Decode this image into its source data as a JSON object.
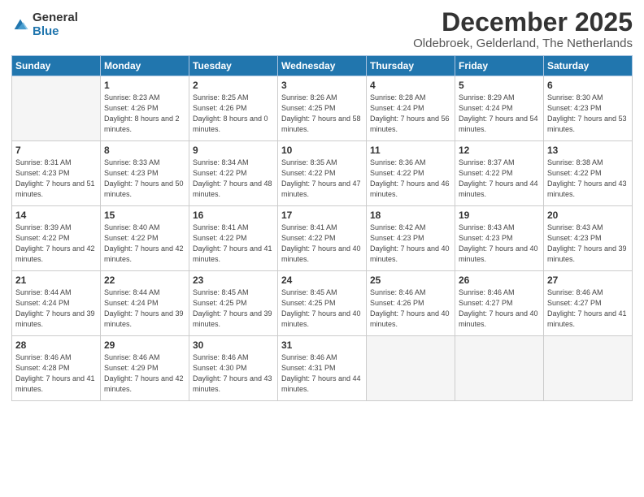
{
  "logo": {
    "general": "General",
    "blue": "Blue"
  },
  "title": "December 2025",
  "subtitle": "Oldebroek, Gelderland, The Netherlands",
  "headers": [
    "Sunday",
    "Monday",
    "Tuesday",
    "Wednesday",
    "Thursday",
    "Friday",
    "Saturday"
  ],
  "weeks": [
    [
      {
        "day": "",
        "sunrise": "",
        "sunset": "",
        "daylight": "",
        "empty": true
      },
      {
        "day": "1",
        "sunrise": "Sunrise: 8:23 AM",
        "sunset": "Sunset: 4:26 PM",
        "daylight": "Daylight: 8 hours and 2 minutes."
      },
      {
        "day": "2",
        "sunrise": "Sunrise: 8:25 AM",
        "sunset": "Sunset: 4:26 PM",
        "daylight": "Daylight: 8 hours and 0 minutes."
      },
      {
        "day": "3",
        "sunrise": "Sunrise: 8:26 AM",
        "sunset": "Sunset: 4:25 PM",
        "daylight": "Daylight: 7 hours and 58 minutes."
      },
      {
        "day": "4",
        "sunrise": "Sunrise: 8:28 AM",
        "sunset": "Sunset: 4:24 PM",
        "daylight": "Daylight: 7 hours and 56 minutes."
      },
      {
        "day": "5",
        "sunrise": "Sunrise: 8:29 AM",
        "sunset": "Sunset: 4:24 PM",
        "daylight": "Daylight: 7 hours and 54 minutes."
      },
      {
        "day": "6",
        "sunrise": "Sunrise: 8:30 AM",
        "sunset": "Sunset: 4:23 PM",
        "daylight": "Daylight: 7 hours and 53 minutes."
      }
    ],
    [
      {
        "day": "7",
        "sunrise": "Sunrise: 8:31 AM",
        "sunset": "Sunset: 4:23 PM",
        "daylight": "Daylight: 7 hours and 51 minutes."
      },
      {
        "day": "8",
        "sunrise": "Sunrise: 8:33 AM",
        "sunset": "Sunset: 4:23 PM",
        "daylight": "Daylight: 7 hours and 50 minutes."
      },
      {
        "day": "9",
        "sunrise": "Sunrise: 8:34 AM",
        "sunset": "Sunset: 4:22 PM",
        "daylight": "Daylight: 7 hours and 48 minutes."
      },
      {
        "day": "10",
        "sunrise": "Sunrise: 8:35 AM",
        "sunset": "Sunset: 4:22 PM",
        "daylight": "Daylight: 7 hours and 47 minutes."
      },
      {
        "day": "11",
        "sunrise": "Sunrise: 8:36 AM",
        "sunset": "Sunset: 4:22 PM",
        "daylight": "Daylight: 7 hours and 46 minutes."
      },
      {
        "day": "12",
        "sunrise": "Sunrise: 8:37 AM",
        "sunset": "Sunset: 4:22 PM",
        "daylight": "Daylight: 7 hours and 44 minutes."
      },
      {
        "day": "13",
        "sunrise": "Sunrise: 8:38 AM",
        "sunset": "Sunset: 4:22 PM",
        "daylight": "Daylight: 7 hours and 43 minutes."
      }
    ],
    [
      {
        "day": "14",
        "sunrise": "Sunrise: 8:39 AM",
        "sunset": "Sunset: 4:22 PM",
        "daylight": "Daylight: 7 hours and 42 minutes."
      },
      {
        "day": "15",
        "sunrise": "Sunrise: 8:40 AM",
        "sunset": "Sunset: 4:22 PM",
        "daylight": "Daylight: 7 hours and 42 minutes."
      },
      {
        "day": "16",
        "sunrise": "Sunrise: 8:41 AM",
        "sunset": "Sunset: 4:22 PM",
        "daylight": "Daylight: 7 hours and 41 minutes."
      },
      {
        "day": "17",
        "sunrise": "Sunrise: 8:41 AM",
        "sunset": "Sunset: 4:22 PM",
        "daylight": "Daylight: 7 hours and 40 minutes."
      },
      {
        "day": "18",
        "sunrise": "Sunrise: 8:42 AM",
        "sunset": "Sunset: 4:23 PM",
        "daylight": "Daylight: 7 hours and 40 minutes."
      },
      {
        "day": "19",
        "sunrise": "Sunrise: 8:43 AM",
        "sunset": "Sunset: 4:23 PM",
        "daylight": "Daylight: 7 hours and 40 minutes."
      },
      {
        "day": "20",
        "sunrise": "Sunrise: 8:43 AM",
        "sunset": "Sunset: 4:23 PM",
        "daylight": "Daylight: 7 hours and 39 minutes."
      }
    ],
    [
      {
        "day": "21",
        "sunrise": "Sunrise: 8:44 AM",
        "sunset": "Sunset: 4:24 PM",
        "daylight": "Daylight: 7 hours and 39 minutes."
      },
      {
        "day": "22",
        "sunrise": "Sunrise: 8:44 AM",
        "sunset": "Sunset: 4:24 PM",
        "daylight": "Daylight: 7 hours and 39 minutes."
      },
      {
        "day": "23",
        "sunrise": "Sunrise: 8:45 AM",
        "sunset": "Sunset: 4:25 PM",
        "daylight": "Daylight: 7 hours and 39 minutes."
      },
      {
        "day": "24",
        "sunrise": "Sunrise: 8:45 AM",
        "sunset": "Sunset: 4:25 PM",
        "daylight": "Daylight: 7 hours and 40 minutes."
      },
      {
        "day": "25",
        "sunrise": "Sunrise: 8:46 AM",
        "sunset": "Sunset: 4:26 PM",
        "daylight": "Daylight: 7 hours and 40 minutes."
      },
      {
        "day": "26",
        "sunrise": "Sunrise: 8:46 AM",
        "sunset": "Sunset: 4:27 PM",
        "daylight": "Daylight: 7 hours and 40 minutes."
      },
      {
        "day": "27",
        "sunrise": "Sunrise: 8:46 AM",
        "sunset": "Sunset: 4:27 PM",
        "daylight": "Daylight: 7 hours and 41 minutes."
      }
    ],
    [
      {
        "day": "28",
        "sunrise": "Sunrise: 8:46 AM",
        "sunset": "Sunset: 4:28 PM",
        "daylight": "Daylight: 7 hours and 41 minutes."
      },
      {
        "day": "29",
        "sunrise": "Sunrise: 8:46 AM",
        "sunset": "Sunset: 4:29 PM",
        "daylight": "Daylight: 7 hours and 42 minutes."
      },
      {
        "day": "30",
        "sunrise": "Sunrise: 8:46 AM",
        "sunset": "Sunset: 4:30 PM",
        "daylight": "Daylight: 7 hours and 43 minutes."
      },
      {
        "day": "31",
        "sunrise": "Sunrise: 8:46 AM",
        "sunset": "Sunset: 4:31 PM",
        "daylight": "Daylight: 7 hours and 44 minutes."
      },
      {
        "day": "",
        "sunrise": "",
        "sunset": "",
        "daylight": "",
        "empty": true
      },
      {
        "day": "",
        "sunrise": "",
        "sunset": "",
        "daylight": "",
        "empty": true
      },
      {
        "day": "",
        "sunrise": "",
        "sunset": "",
        "daylight": "",
        "empty": true
      }
    ]
  ]
}
